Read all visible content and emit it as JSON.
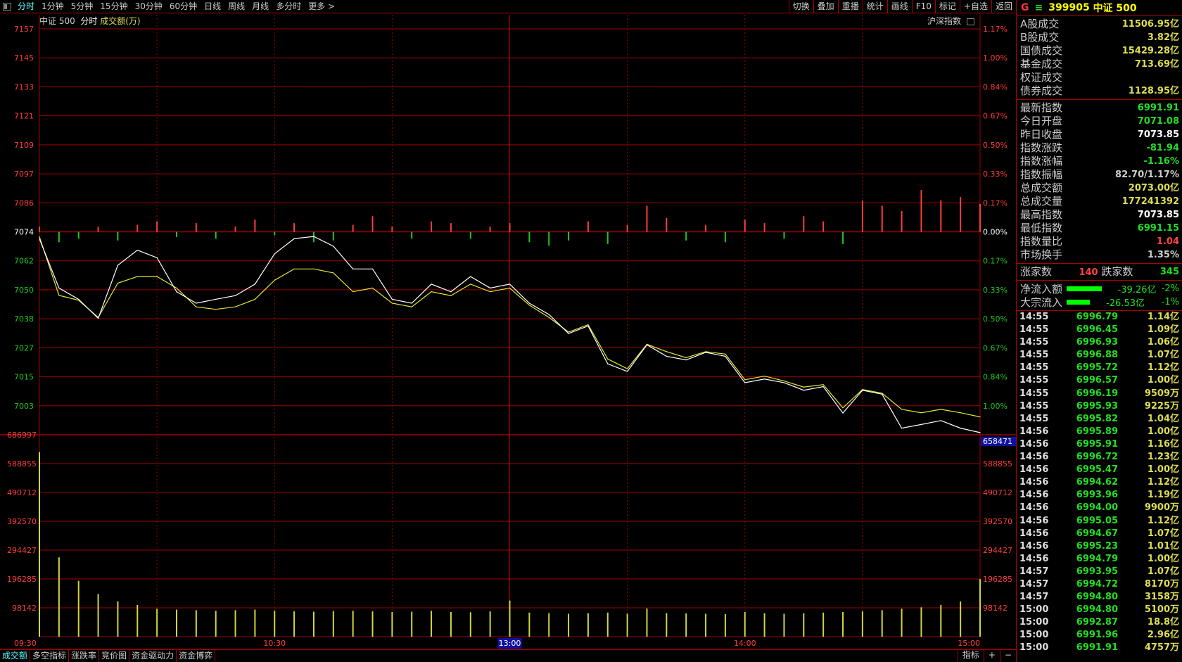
{
  "toolbar": {
    "periods": [
      "分时",
      "1分钟",
      "5分钟",
      "15分钟",
      "30分钟",
      "60分钟",
      "日线",
      "周线",
      "月线",
      "多分时",
      "更多 >"
    ],
    "active": "分时",
    "tools": [
      "切换",
      "叠加",
      "重播",
      "统计",
      "画线",
      "F10",
      "标记",
      "+自选",
      "返回"
    ]
  },
  "subtitle": {
    "name": "中证 500",
    "mode": "分时",
    "indicator": "成交额(万)"
  },
  "overlay_label": "沪深指数",
  "colors": {
    "grid": "#a00000",
    "price_line": "#ffffff",
    "avg_line": "#e6e632",
    "up": "#ff3c3c",
    "down": "#1ec81e",
    "volume": "#d4d43c",
    "highlight": "#1010a0"
  },
  "chart_data": {
    "type": "line",
    "price_axis": {
      "ticks": [
        "7157",
        "7145",
        "7133",
        "7121",
        "7109",
        "7097",
        "7086",
        "7074",
        "7062",
        "7050",
        "7038",
        "7027",
        "7015",
        "7003"
      ],
      "range": [
        6991,
        7157
      ],
      "prev_close": 7074
    },
    "pct_axis": {
      "up": [
        "1.17%",
        "1.00%",
        "0.84%",
        "0.67%",
        "0.50%",
        "0.33%",
        "0.17%"
      ],
      "zero": "0.00%",
      "down": [
        "0.17%",
        "0.33%",
        "0.50%",
        "0.67%",
        "0.84%",
        "1.00%"
      ]
    },
    "volume_axis": {
      "ticks": [
        "686997",
        "588855",
        "490712",
        "392570",
        "294427",
        "196285",
        "98142"
      ],
      "max": 686997,
      "current": "658471"
    },
    "time_labels": [
      "09:30",
      "10:30",
      "13:00",
      "14:00",
      "15:00"
    ],
    "highlight_time": "13:00",
    "times": [
      "09:30",
      "09:35",
      "09:40",
      "09:45",
      "09:50",
      "09:55",
      "10:00",
      "10:05",
      "10:10",
      "10:15",
      "10:20",
      "10:25",
      "10:30",
      "10:35",
      "10:40",
      "10:45",
      "10:50",
      "10:55",
      "11:00",
      "11:05",
      "11:10",
      "11:15",
      "11:20",
      "11:25",
      "11:30",
      "13:05",
      "13:10",
      "13:15",
      "13:20",
      "13:25",
      "13:30",
      "13:35",
      "13:40",
      "13:45",
      "13:50",
      "13:55",
      "14:00",
      "14:05",
      "14:10",
      "14:15",
      "14:20",
      "14:25",
      "14:30",
      "14:35",
      "14:40",
      "14:45",
      "14:50",
      "14:55",
      "15:00"
    ],
    "series": [
      {
        "values": [
          7071.1,
          7051.0,
          7046.4,
          7038.6,
          7060.3,
          7066.5,
          7063.4,
          7049.5,
          7044.8,
          7046.4,
          7047.9,
          7052.6,
          7065.0,
          7071.2,
          7072.1,
          7068.1,
          7058.8,
          7058.8,
          7046.4,
          7044.8,
          7052.6,
          7049.5,
          7055.7,
          7051.0,
          7052.6,
          7044.8,
          7040.2,
          7032.4,
          7035.5,
          7020.0,
          7016.9,
          7027.8,
          7023.1,
          7021.6,
          7024.7,
          7023.1,
          7012.3,
          7013.8,
          7012.3,
          7009.2,
          7010.7,
          6999.9,
          7009.2,
          7007.6,
          6993.7,
          6995.2,
          6996.8,
          6993.7,
          6991.9
        ]
      },
      {
        "values": [
          7072.0,
          7048.0,
          7046.0,
          7039.0,
          7053.0,
          7055.7,
          7055.7,
          7051.0,
          7043.3,
          7042.3,
          7043.3,
          7046.4,
          7054.2,
          7058.8,
          7058.8,
          7057.2,
          7049.5,
          7051.0,
          7044.8,
          7043.3,
          7049.5,
          7047.9,
          7052.6,
          7049.5,
          7051.0,
          7044.0,
          7039.0,
          7033.0,
          7036.0,
          7022.0,
          7018.0,
          7028.0,
          7025.0,
          7022.5,
          7025.0,
          7024.0,
          7013.5,
          7015.0,
          7013.0,
          7010.5,
          7011.5,
          7002.0,
          7009.5,
          7008.0,
          7001.4,
          7000.0,
          7001.4,
          7000.0,
          6998.3
        ]
      }
    ],
    "breadth": [
      0.03,
      -0.06,
      -0.04,
      0.03,
      -0.05,
      0.04,
      0.06,
      -0.03,
      0.05,
      -0.04,
      0.03,
      0.07,
      -0.02,
      0.05,
      -0.06,
      -0.05,
      0.04,
      0.09,
      0.03,
      -0.04,
      0.06,
      0.05,
      -0.04,
      0.03,
      0.05,
      -0.06,
      -0.08,
      -0.05,
      0.06,
      -0.07,
      0.04,
      0.15,
      0.08,
      -0.05,
      0.04,
      -0.06,
      0.07,
      0.05,
      -0.04,
      0.09,
      0.06,
      -0.07,
      0.18,
      0.15,
      0.12,
      0.24,
      0.18,
      0.2,
      0.16
    ],
    "volume": [
      628000,
      270000,
      190000,
      145000,
      120000,
      108000,
      95000,
      92000,
      90000,
      88000,
      90000,
      92000,
      88000,
      86000,
      85000,
      87000,
      88000,
      86000,
      84000,
      85000,
      88000,
      84000,
      83000,
      86000,
      123000,
      82000,
      80000,
      78000,
      80000,
      82000,
      78000,
      96000,
      80000,
      79000,
      78000,
      77000,
      84000,
      80000,
      78000,
      80000,
      82000,
      84000,
      86000,
      90000,
      95000,
      100000,
      108000,
      120000,
      196000
    ]
  },
  "info": {
    "code": "399905",
    "name": "中证 500",
    "g": "G",
    "eq": "≡",
    "turnover": [
      {
        "l": "A股成交",
        "v": "11506.95亿"
      },
      {
        "l": "B股成交",
        "v": "3.82亿"
      },
      {
        "l": "国债成交",
        "v": "15429.28亿"
      },
      {
        "l": "基金成交",
        "v": "713.69亿"
      },
      {
        "l": "权证成交",
        "v": ""
      },
      {
        "l": "债券成交",
        "v": "1128.95亿"
      }
    ],
    "stats": [
      {
        "l": "最新指数",
        "v": "6991.91",
        "c": "grn"
      },
      {
        "l": "今日开盘",
        "v": "7071.08",
        "c": "grn"
      },
      {
        "l": "昨日收盘",
        "v": "7073.85",
        "c": "wht"
      },
      {
        "l": "指数涨跌",
        "v": "-81.94",
        "c": "grn"
      },
      {
        "l": "指数涨幅",
        "v": "-1.16%",
        "c": "grn"
      },
      {
        "l": "指数振幅",
        "v": "82.70/1.17%",
        "c": "lg"
      },
      {
        "l": "总成交额",
        "v": "2073.00亿",
        "c": "yel"
      },
      {
        "l": "总成交量",
        "v": "177241392",
        "c": "yel"
      },
      {
        "l": "最高指数",
        "v": "7073.85",
        "c": "wht"
      },
      {
        "l": "最低指数",
        "v": "6991.15",
        "c": "grn"
      },
      {
        "l": "指数量比",
        "v": "1.04",
        "c": "red"
      },
      {
        "l": "市场换手",
        "v": "1.35%",
        "c": "lg"
      }
    ],
    "adv_label": "涨家数",
    "adv": "140",
    "dec_label": "跌家数",
    "dec": "345",
    "flows": [
      {
        "l": "净流入额",
        "v": "-39.26亿",
        "p": "-2%",
        "bar": 0.45
      },
      {
        "l": "大宗流入",
        "v": "-26.53亿",
        "p": "-1%",
        "bar": 0.3
      }
    ]
  },
  "ticks": [
    [
      "14:55",
      "6996.79",
      "1.14亿"
    ],
    [
      "14:55",
      "6996.45",
      "1.09亿"
    ],
    [
      "14:55",
      "6996.93",
      "1.06亿"
    ],
    [
      "14:55",
      "6996.88",
      "1.07亿"
    ],
    [
      "14:55",
      "6995.72",
      "1.12亿"
    ],
    [
      "14:55",
      "6996.57",
      "1.00亿"
    ],
    [
      "14:55",
      "6996.19",
      "9509万"
    ],
    [
      "14:55",
      "6995.93",
      "9225万"
    ],
    [
      "14:55",
      "6995.82",
      "1.04亿"
    ],
    [
      "14:56",
      "6995.89",
      "1.00亿"
    ],
    [
      "14:56",
      "6995.91",
      "1.16亿"
    ],
    [
      "14:56",
      "6996.72",
      "1.23亿"
    ],
    [
      "14:56",
      "6995.47",
      "1.00亿"
    ],
    [
      "14:56",
      "6994.62",
      "1.12亿"
    ],
    [
      "14:56",
      "6993.96",
      "1.19亿"
    ],
    [
      "14:56",
      "6994.00",
      "9900万"
    ],
    [
      "14:56",
      "6995.05",
      "1.12亿"
    ],
    [
      "14:56",
      "6994.67",
      "1.07亿"
    ],
    [
      "14:56",
      "6995.23",
      "1.01亿"
    ],
    [
      "14:56",
      "6994.79",
      "1.00亿"
    ],
    [
      "14:57",
      "6993.95",
      "1.07亿"
    ],
    [
      "14:57",
      "6994.72",
      "8170万"
    ],
    [
      "14:57",
      "6994.80",
      "3158万"
    ],
    [
      "15:00",
      "6994.80",
      "5100万"
    ],
    [
      "15:00",
      "6992.87",
      "18.8亿"
    ],
    [
      "15:00",
      "6991.96",
      "2.96亿"
    ],
    [
      "15:00",
      "6991.91",
      "4757万"
    ]
  ],
  "bottom_tabs": [
    "成交额",
    "多空指标",
    "涨跌率",
    "竞价图",
    "资金驱动力",
    "资金博弈"
  ],
  "bottom_right": [
    "指标",
    "+",
    "−"
  ]
}
